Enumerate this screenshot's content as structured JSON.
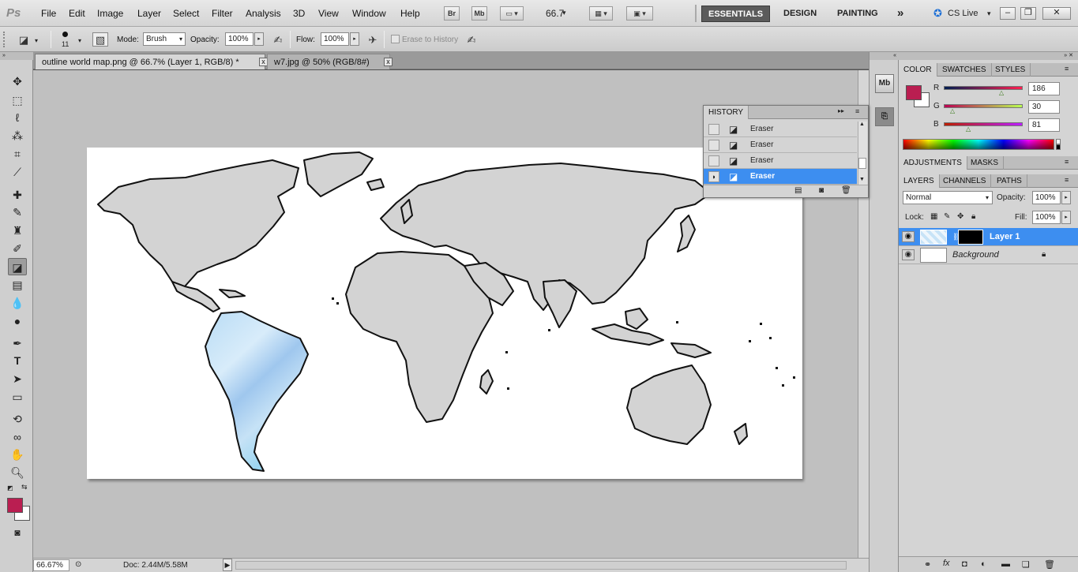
{
  "app": {
    "logo": "Ps",
    "menu": [
      "File",
      "Edit",
      "Image",
      "Layer",
      "Select",
      "Filter",
      "Analysis",
      "3D",
      "View",
      "Window",
      "Help"
    ],
    "bridge_btn": "Br",
    "minibridge_btn": "Mb",
    "zoom_level": "66.7",
    "workspaces": [
      "ESSENTIALS",
      "DESIGN",
      "PAINTING"
    ],
    "more": "»",
    "cs_live": "CS Live"
  },
  "options": {
    "brush_size": "11",
    "mode_label": "Mode:",
    "mode_value": "Brush",
    "opacity_label": "Opacity:",
    "opacity_value": "100%",
    "flow_label": "Flow:",
    "flow_value": "100%",
    "erase_history_label": "Erase to History"
  },
  "tabs": [
    {
      "label": "outline world map.png @ 66.7% (Layer 1, RGB/8) *",
      "close": "x"
    },
    {
      "label": "w7.jpg @ 50% (RGB/8#)",
      "close": "x"
    }
  ],
  "status": {
    "zoom": "66.67%",
    "doc": "Doc: 2.44M/5.58M"
  },
  "history": {
    "title": "HISTORY",
    "items": [
      "Eraser",
      "Eraser",
      "Eraser",
      "Eraser"
    ],
    "selected_index": 3
  },
  "color_panel": {
    "tabs": [
      "COLOR",
      "SWATCHES",
      "STYLES"
    ],
    "channels": [
      {
        "label": "R",
        "value": "186"
      },
      {
        "label": "G",
        "value": "30"
      },
      {
        "label": "B",
        "value": "81"
      }
    ],
    "foreground": "#ba1e51"
  },
  "adjustments_panel": {
    "tabs": [
      "ADJUSTMENTS",
      "MASKS"
    ]
  },
  "layers_panel": {
    "tabs": [
      "LAYERS",
      "CHANNELS",
      "PATHS"
    ],
    "blend_mode": "Normal",
    "opacity_label": "Opacity:",
    "opacity_value": "100%",
    "lock_label": "Lock:",
    "fill_label": "Fill:",
    "fill_value": "100%",
    "layers": [
      {
        "name": "Layer 1",
        "selected": true
      },
      {
        "name": "Background",
        "selected": false,
        "locked": true
      }
    ]
  },
  "colors": {
    "accent": "#3d8ef0",
    "foreground_swatch": "#ba1e51",
    "workspace_bg": "#c0c0c0"
  }
}
